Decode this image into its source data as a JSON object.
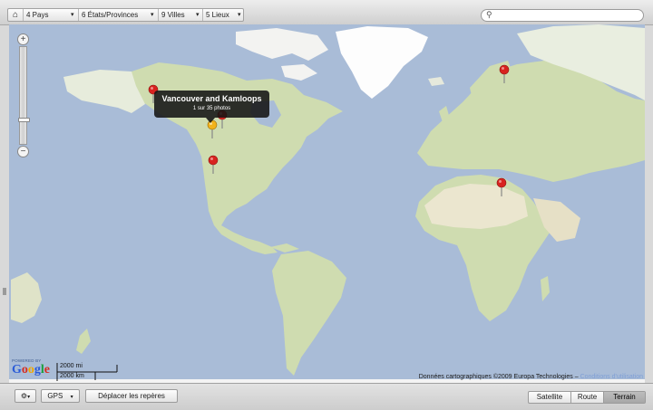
{
  "breadcrumb": {
    "countries": "4 Pays",
    "provinces": "6 États/Provinces",
    "cities": "9 Villes",
    "places": "5 Lieux"
  },
  "search": {
    "placeholder": ""
  },
  "tooltip": {
    "title": "Vancouver and Kamloops",
    "subtitle": "1 sur 35 photos"
  },
  "map_footer": {
    "powered_by": "POWERED BY",
    "logo": "Google",
    "scale_miles": "2000 mi",
    "scale_km": "2000 km",
    "credits": "Données cartographiques ©2009 Europa Technologies –",
    "terms_link": "Conditions d'utilisation"
  },
  "bottom_toolbar": {
    "gps_label": "GPS",
    "move_pins_label": "Déplacer les repères",
    "map_types": [
      "Satellite",
      "Route",
      "Terrain"
    ],
    "active_map_type": "Terrain"
  },
  "colors": {
    "ocean": "#a9bcd7",
    "land": "#cfdcb0",
    "desert": "#ebe6cf",
    "ice": "#ffffff",
    "pin": "#d8231f",
    "pin_selected": "#f2b31c"
  }
}
